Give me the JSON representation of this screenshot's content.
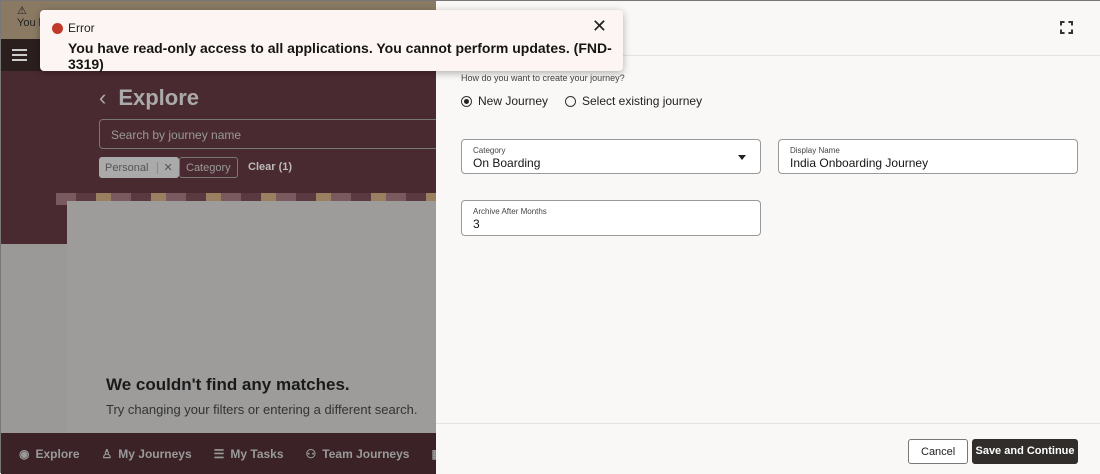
{
  "warning": {
    "text": "You h"
  },
  "toast": {
    "title": "Error",
    "message": "You have read-only access to all applications. You cannot perform updates. (FND-3319)"
  },
  "explore": {
    "title": "Explore",
    "search_placeholder": "Search by journey name",
    "chips": {
      "personal": "Personal",
      "category": "Category",
      "clear": "Clear (1)"
    },
    "empty_title": "We couldn't find any matches.",
    "empty_sub": "Try changing your filters or entering a different search."
  },
  "nav": [
    "Explore",
    "My Journeys",
    "My Tasks",
    "Team Journeys"
  ],
  "panel": {
    "question": "How do you want to create your journey?",
    "options": [
      "New Journey",
      "Select existing journey"
    ],
    "category_label": "Category",
    "category_value": "On Boarding",
    "display_label": "Display Name",
    "display_value": "India Onboarding Journey",
    "archive_label": "Archive After Months",
    "archive_value": "3",
    "cancel": "Cancel",
    "save": "Save and Continue"
  }
}
